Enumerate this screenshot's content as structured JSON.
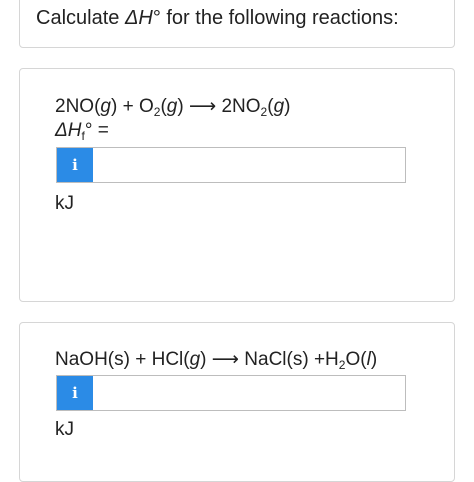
{
  "header": {
    "prefix": "Calculate ",
    "delta": "ΔH",
    "suffix": "° for the following reactions:"
  },
  "questions": [
    {
      "reaction": {
        "p1": "2NO(",
        "s1": "g",
        "p2": ") + O",
        "sub1": "2",
        "p3": "(",
        "s2": "g",
        "p4": ") ⟶ 2NO",
        "sub2": "2",
        "p5": "(",
        "s3": "g",
        "p6": ")"
      },
      "label": {
        "delta": "ΔH",
        "sub": "f",
        "rest": "° ="
      },
      "input_value": "",
      "info_icon": "i",
      "unit": "kJ"
    },
    {
      "reaction": {
        "p1": "NaOH(s) + HCl(",
        "s1": "g",
        "p2": ") ⟶ NaCl(s) +H",
        "sub1": "2",
        "p3": "O(",
        "s2": "l",
        "p4": ")"
      },
      "input_value": "",
      "info_icon": "i",
      "unit": "kJ"
    }
  ],
  "colors": {
    "info_button": "#2b8be6",
    "border": "#d6d6d6"
  }
}
